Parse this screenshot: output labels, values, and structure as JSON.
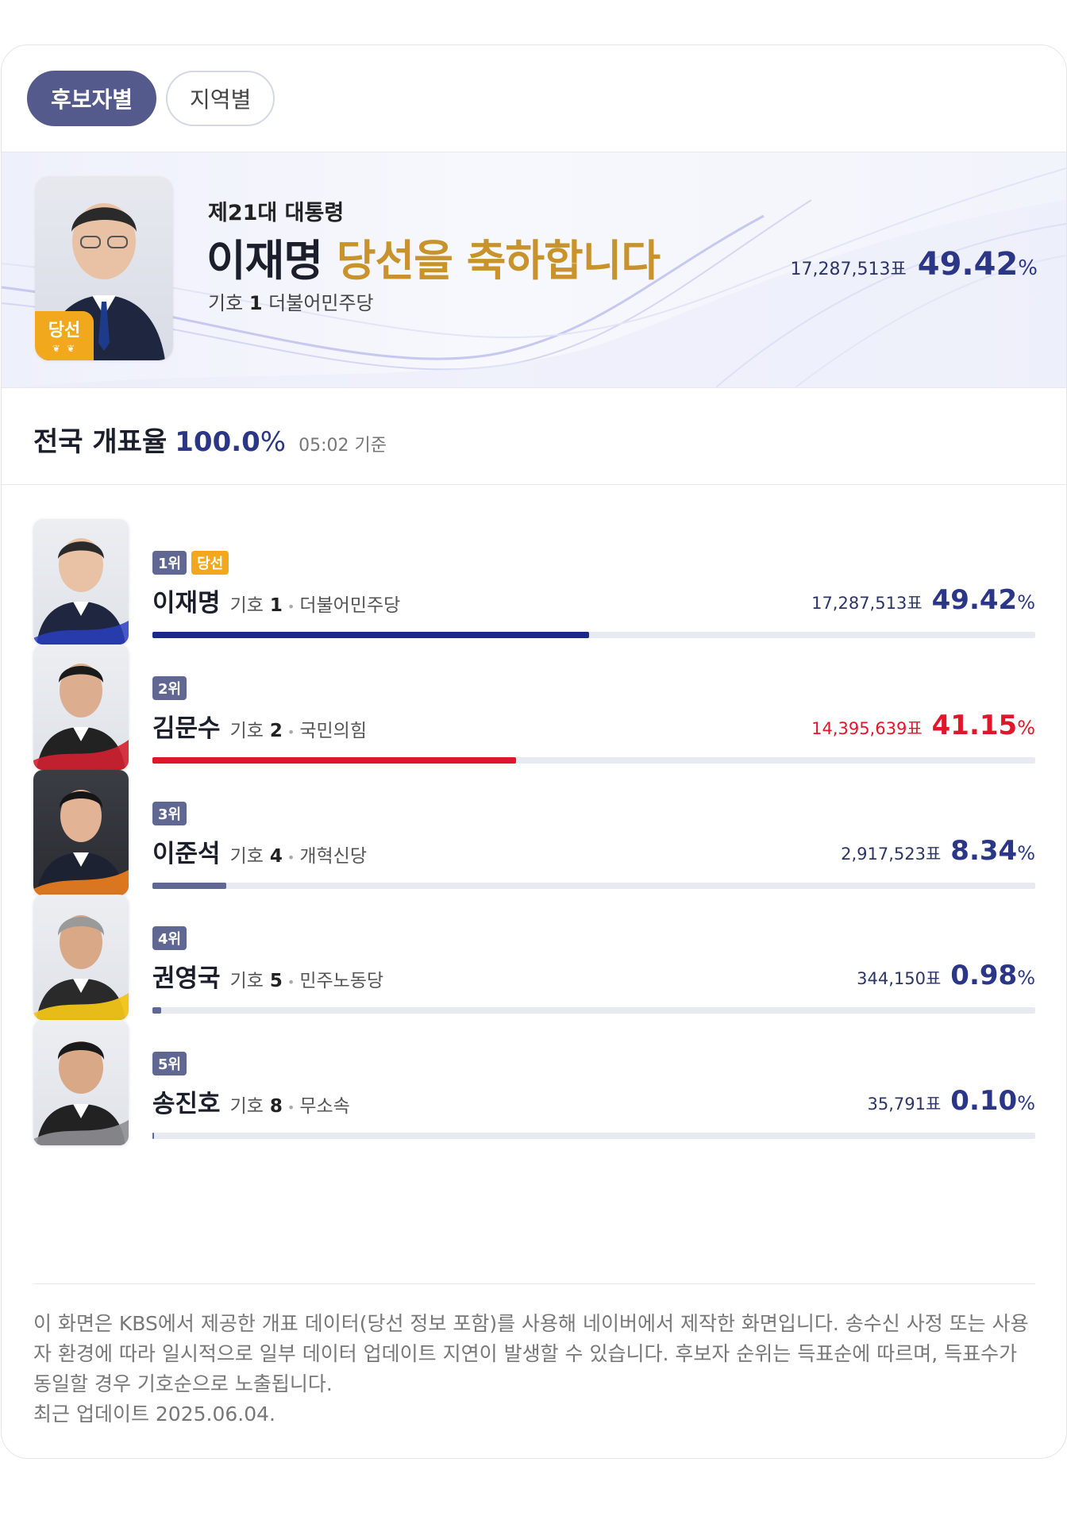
{
  "tabs": [
    {
      "label": "후보자별",
      "active": true
    },
    {
      "label": "지역별",
      "active": false
    }
  ],
  "banner": {
    "subtitle": "제21대 대통령",
    "name": "이재명",
    "congrats": "당선을 축하합니다",
    "symbol_label": "기호",
    "symbol_number": "1",
    "party": "더불어민주당",
    "votes": "17,287,513표",
    "percent": "49.42",
    "percent_unit": "%",
    "elected_badge": "당선"
  },
  "count": {
    "label": "전국 개표율",
    "rate": "100.0",
    "rate_unit": "%",
    "time": "05:02 기준"
  },
  "candidates": [
    {
      "rank": "1위",
      "elected": "당선",
      "name": "이재명",
      "symbol_label": "기호",
      "symbol_number": "1",
      "party": "더불어민주당",
      "votes": "17,287,513표",
      "percent": "49.42",
      "percent_unit": "%",
      "share": 49.42,
      "color": "#1b2a8a",
      "pct_color": "#2b3686"
    },
    {
      "rank": "2위",
      "elected": "",
      "name": "김문수",
      "symbol_label": "기호",
      "symbol_number": "2",
      "party": "국민의힘",
      "votes": "14,395,639표",
      "percent": "41.15",
      "percent_unit": "%",
      "share": 41.15,
      "color": "#e0172a",
      "pct_color": "#e0172a"
    },
    {
      "rank": "3위",
      "elected": "",
      "name": "이준석",
      "symbol_label": "기호",
      "symbol_number": "4",
      "party": "개혁신당",
      "votes": "2,917,523표",
      "percent": "8.34",
      "percent_unit": "%",
      "share": 8.34,
      "color": "#5f6792",
      "pct_color": "#2b3686"
    },
    {
      "rank": "4위",
      "elected": "",
      "name": "권영국",
      "symbol_label": "기호",
      "symbol_number": "5",
      "party": "민주노동당",
      "votes": "344,150표",
      "percent": "0.98",
      "percent_unit": "%",
      "share": 0.98,
      "color": "#5f6792",
      "pct_color": "#2b3686"
    },
    {
      "rank": "5위",
      "elected": "",
      "name": "송진호",
      "symbol_label": "기호",
      "symbol_number": "8",
      "party": "무소속",
      "votes": "35,791표",
      "percent": "0.10",
      "percent_unit": "%",
      "share": 0.1,
      "color": "#5f6792",
      "pct_color": "#2b3686"
    }
  ],
  "footer": {
    "notice": "이 화면은 KBS에서 제공한 개표 데이터(당선 정보 포함)를 사용해 네이버에서 제작한 화면입니다. 송수신 사정 또는 사용자 환경에 따라 일시적으로 일부 데이터 업데이트 지연이 발생할 수 있습니다. 후보자 순위는 득표순에 따르며, 득표수가 동일할 경우 기호순으로 노출됩니다.",
    "updated": "최근 업데이트 2025.06.04."
  },
  "icons": {
    "elected_laurel": "laurel-icon",
    "candidate_photo": "person-portrait-icon"
  }
}
